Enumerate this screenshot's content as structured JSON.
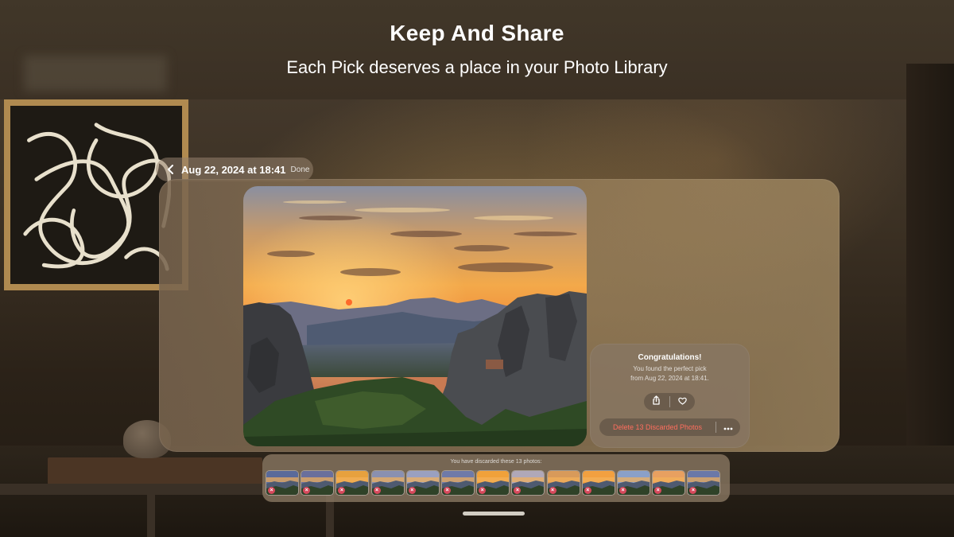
{
  "header": {
    "title": "Keep And Share",
    "subtitle": "Each Pick deserves a place in your Photo Library"
  },
  "nav": {
    "back_icon": "chevron-left-icon",
    "date": "Aug 22, 2024 at 18:41",
    "done_label": "Done"
  },
  "card": {
    "title": "Congratulations!",
    "line1": "You found the perfect pick",
    "line2": "from Aug 22, 2024 at 18:41.",
    "share_icon": "share-icon",
    "favorite_icon": "heart-icon",
    "delete_label": "Delete 13 Discarded Photos",
    "more_icon": "ellipsis-icon"
  },
  "discarded": {
    "label": "You have discarded these 13 photos:",
    "count": 13,
    "badge_symbol": "×"
  },
  "colors": {
    "delete_text": "#ff6e5e",
    "discard_badge": "#d6495c"
  }
}
